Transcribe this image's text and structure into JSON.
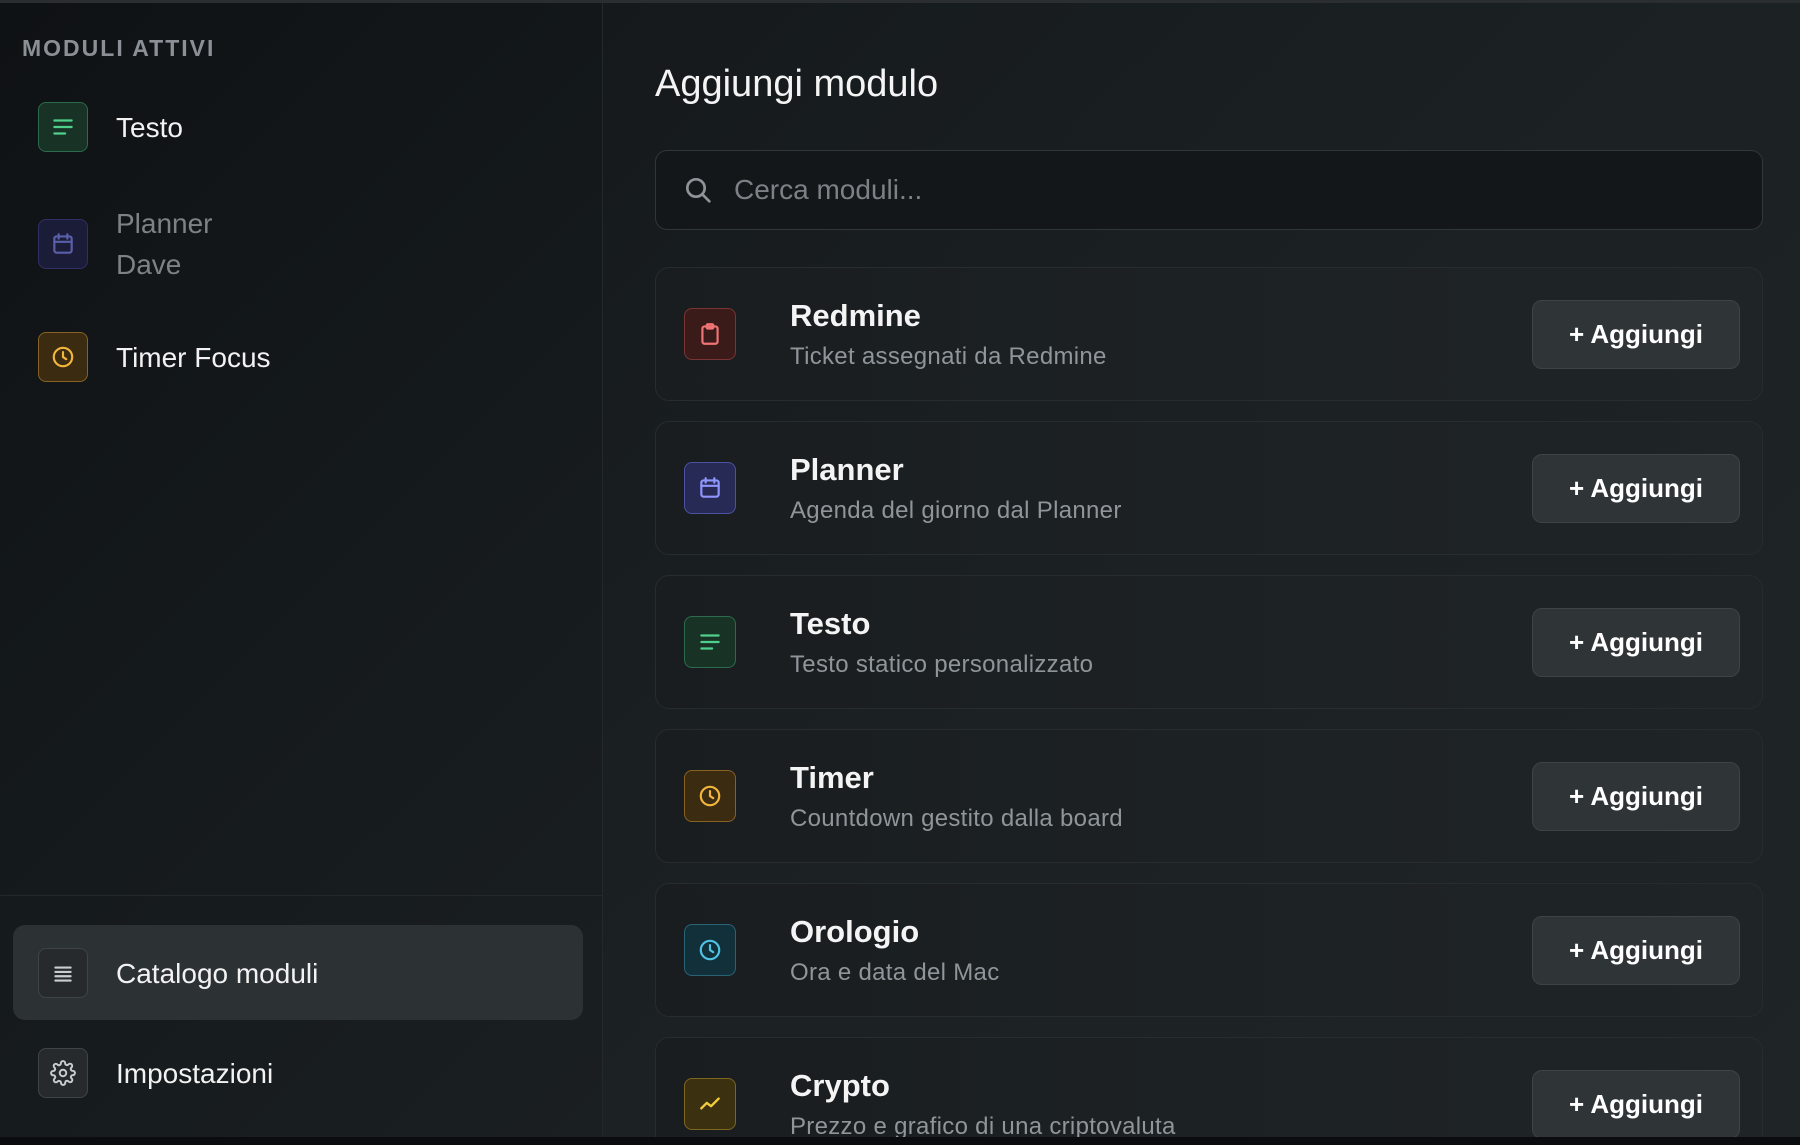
{
  "sidebar": {
    "section_title": "MODULI ATTIVI",
    "active_modules": [
      {
        "label": "Testo",
        "icon": "text-lines-icon"
      },
      {
        "label_line1": "Planner",
        "label_line2": "Dave",
        "icon": "calendar-icon"
      },
      {
        "label": "Timer Focus",
        "icon": "clock-icon"
      }
    ],
    "nav": [
      {
        "label": "Catalogo moduli",
        "icon": "list-icon",
        "selected": true
      },
      {
        "label": "Impostazioni",
        "icon": "gear-icon",
        "selected": false
      }
    ]
  },
  "main": {
    "title": "Aggiungi modulo",
    "search": {
      "placeholder": "Cerca moduli...",
      "value": ""
    },
    "add_label": "+ Aggiungi",
    "modules": [
      {
        "name": "Redmine",
        "description": "Ticket assegnati da Redmine",
        "icon": "clipboard-icon",
        "color": "#f07474"
      },
      {
        "name": "Planner",
        "description": "Agenda del giorno dal Planner",
        "icon": "calendar-icon",
        "color": "#8f96ff"
      },
      {
        "name": "Testo",
        "description": "Testo statico personalizzato",
        "icon": "text-lines-icon",
        "color": "#4ed08b"
      },
      {
        "name": "Timer",
        "description": "Countdown gestito dalla board",
        "icon": "clock-icon",
        "color": "#f2b63c"
      },
      {
        "name": "Orologio",
        "description": "Ora e data del Mac",
        "icon": "clock-icon",
        "color": "#4fc2e4"
      },
      {
        "name": "Crypto",
        "description": "Prezzo e grafico di una criptovaluta",
        "icon": "trend-line-icon",
        "color": "#f2cc3c"
      }
    ]
  }
}
